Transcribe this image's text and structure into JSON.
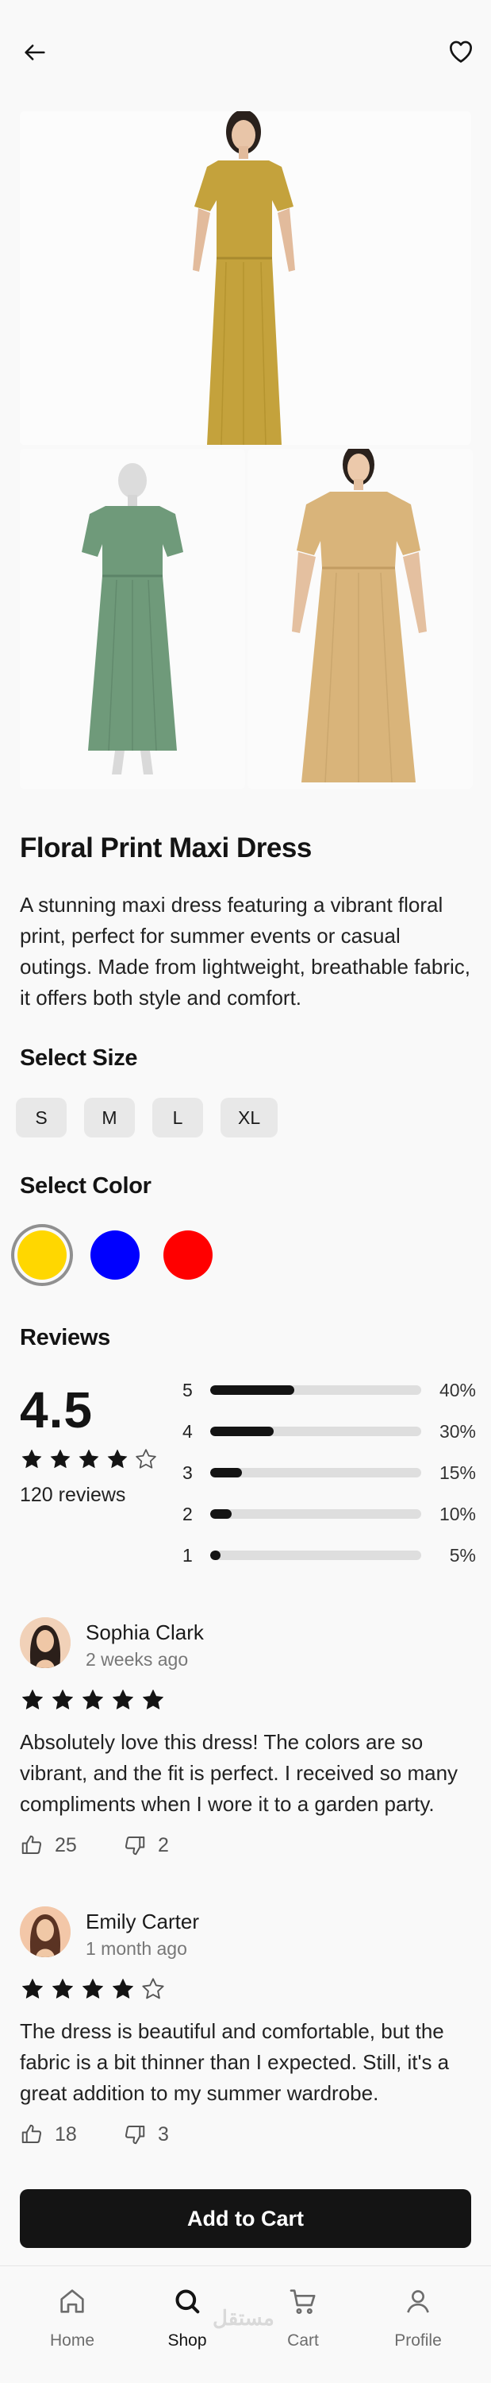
{
  "product": {
    "title": "Floral Print Maxi Dress",
    "description": "A stunning maxi dress featuring a vibrant floral print, perfect for summer events or casual outings. Made from lightweight, breathable fabric, it offers both style and comfort."
  },
  "size_section": {
    "heading": "Select Size",
    "options": [
      "S",
      "M",
      "L",
      "XL"
    ]
  },
  "color_section": {
    "heading": "Select Color",
    "options": [
      "#ffd700",
      "#0000ff",
      "#ff0000"
    ],
    "selected": 0
  },
  "reviews": {
    "heading": "Reviews",
    "average": "4.5",
    "count_label": "120 reviews",
    "average_stars": 4,
    "distribution": [
      {
        "stars": "5",
        "percent": "40%",
        "fraction": 0.4
      },
      {
        "stars": "4",
        "percent": "30%",
        "fraction": 0.3
      },
      {
        "stars": "3",
        "percent": "15%",
        "fraction": 0.15
      },
      {
        "stars": "2",
        "percent": "10%",
        "fraction": 0.1
      },
      {
        "stars": "1",
        "percent": "5%",
        "fraction": 0.05
      }
    ],
    "items": [
      {
        "name": "Sophia Clark",
        "date": "2 weeks ago",
        "rating": 5,
        "text": "Absolutely love this dress! The colors are so vibrant, and the fit is perfect. I received so many compliments when I wore it to a garden party.",
        "likes": "25",
        "dislikes": "2"
      },
      {
        "name": "Emily Carter",
        "date": "1 month ago",
        "rating": 4,
        "text": "The dress is beautiful and comfortable, but the fabric is a bit thinner than I expected. Still, it's a great addition to my summer wardrobe.",
        "likes": "18",
        "dislikes": "3"
      }
    ]
  },
  "cta": {
    "label": "Add to Cart"
  },
  "tabbar": {
    "tabs": [
      {
        "label": "Home",
        "icon": "home-icon"
      },
      {
        "label": "Shop",
        "icon": "search-icon",
        "active": true
      },
      {
        "label": "Cart",
        "icon": "cart-icon"
      },
      {
        "label": "Profile",
        "icon": "profile-icon"
      }
    ],
    "watermark": "مستقل"
  },
  "colors": {
    "accent": "#141414",
    "muted": "#e8e8e8",
    "dress_mustard": "#c4a23c",
    "dress_green": "#6f9a7a",
    "dress_beige": "#d9b47a"
  }
}
